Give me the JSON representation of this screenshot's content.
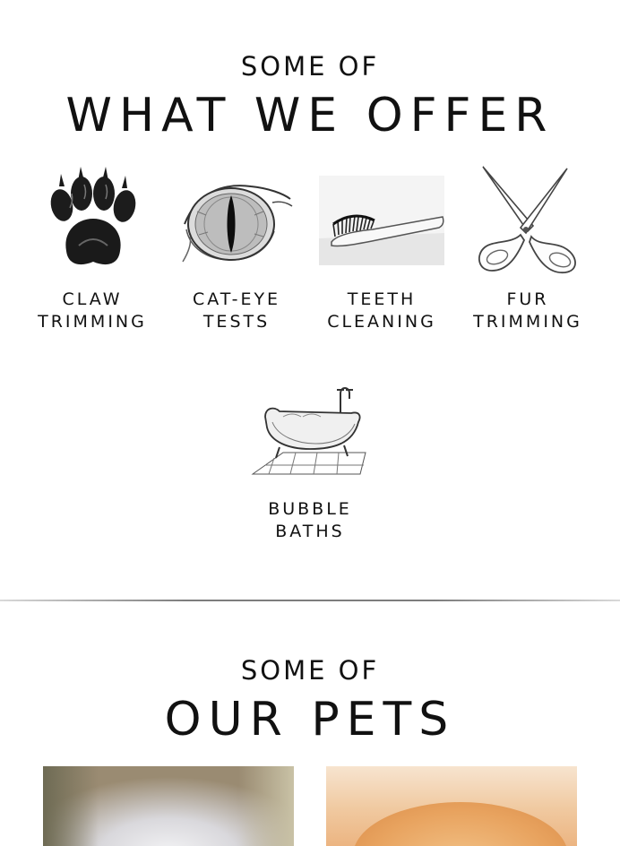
{
  "offer_section": {
    "kicker": "SOME OF",
    "title": "WHAT WE OFFER",
    "services": [
      {
        "label": "CLAW\nTRIMMING",
        "icon": "paw-icon"
      },
      {
        "label": "CAT-EYE\nTESTS",
        "icon": "cat-eye-icon"
      },
      {
        "label": "TEETH\nCLEANING",
        "icon": "toothbrush-icon"
      },
      {
        "label": "FUR\nTRIMMING",
        "icon": "scissors-icon"
      },
      {
        "label": "BUBBLE\nBATHS",
        "icon": "bathtub-icon"
      }
    ]
  },
  "pets_section": {
    "kicker": "SOME OF",
    "title": "OUR PETS",
    "photos": [
      {
        "subject": "white fluffy kitten photo"
      },
      {
        "subject": "orange cat photo"
      }
    ]
  }
}
